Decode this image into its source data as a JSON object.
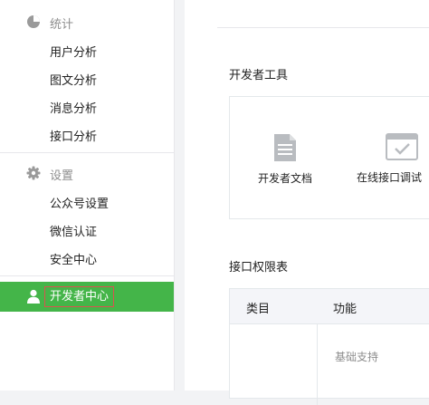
{
  "sidebar": {
    "stats": {
      "label": "统计",
      "icon": "pie-chart-icon",
      "items": [
        "用户分析",
        "图文分析",
        "消息分析",
        "接口分析"
      ]
    },
    "settings": {
      "label": "设置",
      "icon": "gear-icon",
      "items": [
        "公众号设置",
        "微信认证",
        "安全中心"
      ]
    },
    "developer": {
      "label": "开发者中心",
      "icon": "user-icon"
    }
  },
  "main": {
    "tools_title": "开发者工具",
    "tools": [
      {
        "label": "开发者文档",
        "icon": "document-icon"
      },
      {
        "label": "在线接口调试",
        "icon": "window-check-icon"
      }
    ],
    "permissions_title": "接口权限表",
    "table": {
      "headers": [
        "类目",
        "功能"
      ],
      "rows": [
        [
          "",
          "基础支持"
        ]
      ]
    }
  },
  "colors": {
    "accent": "#44b549",
    "highlight_border": "#d9534f",
    "muted_text": "#8d8d8d"
  }
}
